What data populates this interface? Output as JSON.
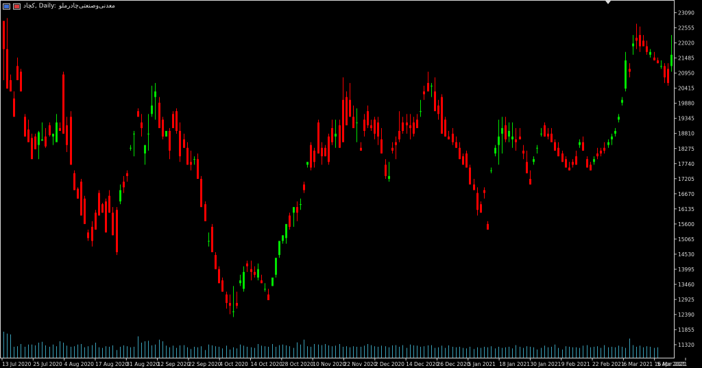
{
  "header": {
    "title": "کچاد, Daily:",
    "subtitle": "معدنی‌وصنعتی‌چادرملو"
  },
  "colors": {
    "background": "#000000",
    "up": "#00e600",
    "down": "#ff0000",
    "volume": "#3aa0b8",
    "text": "#dddddd",
    "axis": "#c8c8c8"
  },
  "chart_data": {
    "type": "candlestick",
    "title": "کچاد, Daily:",
    "subtitle": "معدنی‌وصنعتی‌چادرملو",
    "x_tick_labels": [
      "13 Jul 2020",
      "25 Jul 2020",
      "4 Aug 2020",
      "17 Aug 2020",
      "31 Aug 2020",
      "12 Sep 2020",
      "22 Sep 2020",
      "4 Oct 2020",
      "14 Oct 2020",
      "28 Oct 2020",
      "10 Nov 2020",
      "22 Nov 2020",
      "2 Dec 2020",
      "14 Dec 2020",
      "26 Dec 2020",
      "5 Jan 2021",
      "18 Jan 2021",
      "30 Jan 2021",
      "9 Feb 2021",
      "22 Feb 2021",
      "6 Mar 2021",
      "16 Mar 2021",
      "5 Apr 2021"
    ],
    "y_tick_labels": [
      "23090",
      "22555",
      "22020",
      "21485",
      "20950",
      "20415",
      "19880",
      "19345",
      "18810",
      "18275",
      "17740",
      "17205",
      "16670",
      "16135",
      "15600",
      "15065",
      "14530",
      "13995",
      "13460",
      "12925",
      "12390",
      "11855",
      "11320"
    ],
    "ylim": [
      11150,
      23250
    ],
    "volume_scale_max": 100,
    "candles": [
      [
        22800,
        22800,
        20700,
        21800
      ],
      [
        21800,
        22900,
        20500,
        20400
      ],
      [
        20700,
        20900,
        20300,
        20300
      ],
      [
        20050,
        20300,
        19400,
        19400
      ],
      [
        21200,
        21500,
        20700,
        20700
      ],
      [
        21000,
        21100,
        20300,
        20300
      ],
      [
        19400,
        19500,
        18700,
        18700
      ],
      [
        18950,
        19300,
        18500,
        18500
      ],
      [
        18650,
        18800,
        17900,
        17900
      ],
      [
        18700,
        18800,
        18250,
        18250
      ],
      [
        18400,
        18900,
        17900,
        18850
      ],
      [
        18550,
        19200,
        18600,
        18600
      ],
      [
        18700,
        19000,
        18300,
        18350
      ],
      [
        19100,
        19200,
        18700,
        18750
      ],
      [
        18700,
        18800,
        18400,
        18800
      ],
      [
        18500,
        19500,
        18500,
        19200
      ],
      [
        19000,
        19200,
        18900,
        18900
      ],
      [
        20900,
        21000,
        18800,
        18800
      ],
      [
        19100,
        19400,
        18150,
        18400
      ],
      [
        19400,
        19600,
        17700,
        17700
      ],
      [
        17400,
        17500,
        16800,
        16800
      ],
      [
        16850,
        16900,
        16500,
        16500
      ],
      [
        17100,
        17200,
        15900,
        15900
      ],
      [
        16500,
        16600,
        15600,
        15600
      ],
      [
        15300,
        15400,
        15000,
        15100
      ],
      [
        15500,
        15700,
        14800,
        15000
      ],
      [
        16000,
        16100,
        15400,
        15400
      ],
      [
        16700,
        16800,
        15900,
        15900
      ],
      [
        16300,
        16350,
        16000,
        16000
      ],
      [
        16400,
        16500,
        15300,
        15300
      ],
      [
        16600,
        16800,
        16000,
        16000
      ],
      [
        16000,
        16200,
        15200,
        15200
      ],
      [
        16100,
        16200,
        14500,
        14600
      ],
      [
        16400,
        17000,
        16300,
        16800
      ],
      [
        17100,
        17300,
        16700,
        16900
      ],
      [
        17400,
        17500,
        17100,
        17300
      ],
      [
        18300,
        18400,
        18200,
        18300
      ],
      [
        18800,
        18900,
        18000,
        18800
      ],
      [
        19600,
        19700,
        19500,
        19400
      ],
      [
        19200,
        19500,
        18700,
        19000
      ],
      [
        18100,
        18300,
        17700,
        18400
      ],
      [
        18800,
        19500,
        18200,
        18800
      ],
      [
        19500,
        20500,
        19400,
        19800
      ],
      [
        20100,
        20600,
        19300,
        20300
      ],
      [
        19900,
        20100,
        19400,
        19000
      ],
      [
        19300,
        19400,
        18600,
        18700
      ],
      [
        18700,
        18800,
        18700,
        18900
      ],
      [
        18900,
        19000,
        17900,
        18200
      ],
      [
        19500,
        19600,
        19100,
        19000
      ],
      [
        19600,
        19700,
        18800,
        18900
      ],
      [
        18900,
        19200,
        17800,
        18000
      ],
      [
        18600,
        18800,
        18300,
        18300
      ],
      [
        18300,
        18500,
        17700,
        17700
      ],
      [
        17800,
        18200,
        17500,
        17700
      ],
      [
        17900,
        18000,
        17700,
        17900
      ],
      [
        17900,
        18100,
        17200,
        17200
      ],
      [
        17200,
        17300,
        16200,
        16200
      ],
      [
        16300,
        16400,
        15800,
        15700
      ],
      [
        15000,
        15300,
        14800,
        15000
      ],
      [
        15500,
        15600,
        14700,
        14600
      ],
      [
        14500,
        14600,
        14000,
        14000
      ],
      [
        14000,
        14100,
        13500,
        13500
      ],
      [
        13600,
        13700,
        13200,
        13200
      ],
      [
        13100,
        13200,
        12600,
        12800
      ],
      [
        12800,
        13100,
        12400,
        12700
      ],
      [
        12500,
        13400,
        12300,
        12500
      ],
      [
        12800,
        13200,
        12600,
        12700
      ],
      [
        13500,
        13800,
        13400,
        13600
      ],
      [
        13300,
        14100,
        13200,
        13900
      ],
      [
        14200,
        14300,
        13900,
        14100
      ],
      [
        14000,
        14300,
        13600,
        13900
      ],
      [
        13900,
        14100,
        13700,
        13800
      ],
      [
        13700,
        14200,
        13600,
        14000
      ],
      [
        13600,
        13800,
        13500,
        13500
      ],
      [
        13300,
        13500,
        13200,
        13300
      ],
      [
        13100,
        13300,
        13000,
        12900
      ],
      [
        13400,
        13500,
        13400,
        13700
      ],
      [
        13800,
        14000,
        13700,
        14400
      ],
      [
        14500,
        14800,
        14400,
        15000
      ],
      [
        15000,
        15200,
        14900,
        15200
      ],
      [
        15100,
        15300,
        14900,
        15600
      ],
      [
        15900,
        16000,
        15400,
        15500
      ],
      [
        16000,
        16200,
        15500,
        16200
      ],
      [
        16200,
        16400,
        15700,
        16000
      ],
      [
        16300,
        16500,
        16100,
        16300
      ],
      [
        17000,
        17100,
        16700,
        16800
      ],
      [
        17700,
        17800,
        17600,
        17800
      ],
      [
        18400,
        18500,
        17500,
        17600
      ],
      [
        18200,
        18300,
        17600,
        17800
      ],
      [
        19200,
        19300,
        18100,
        18100
      ],
      [
        18300,
        18500,
        17700,
        18000
      ],
      [
        18300,
        18400,
        18000,
        18000
      ],
      [
        18700,
        18800,
        17700,
        17800
      ],
      [
        19000,
        19300,
        18400,
        18500
      ],
      [
        18700,
        19300,
        18300,
        18800
      ],
      [
        19100,
        19300,
        18400,
        18300
      ],
      [
        20000,
        20800,
        18900,
        18500
      ],
      [
        20100,
        20300,
        19200,
        19100
      ],
      [
        20000,
        20600,
        19600,
        19400
      ],
      [
        19400,
        19800,
        19000,
        19000
      ],
      [
        19200,
        19700,
        18500,
        19200
      ],
      [
        18300,
        18500,
        18200,
        18200
      ],
      [
        19300,
        19500,
        18700,
        18900
      ],
      [
        19600,
        19800,
        19000,
        19100
      ],
      [
        19100,
        19300,
        18900,
        19000
      ],
      [
        19300,
        19400,
        18600,
        18800
      ],
      [
        19200,
        19400,
        18400,
        18700
      ],
      [
        18600,
        19000,
        18100,
        18100
      ],
      [
        17700,
        17900,
        17200,
        17300
      ],
      [
        17200,
        17800,
        17100,
        17300
      ],
      [
        18300,
        18500,
        18100,
        18200
      ],
      [
        18500,
        18700,
        17900,
        18400
      ],
      [
        18900,
        19600,
        18500,
        18600
      ],
      [
        19200,
        19400,
        18800,
        18900
      ],
      [
        19200,
        19500,
        18800,
        19100
      ],
      [
        19100,
        19500,
        18600,
        19000
      ],
      [
        19200,
        19400,
        18700,
        18800
      ],
      [
        19300,
        19500,
        19000,
        19000
      ],
      [
        19600,
        20000,
        19400,
        19600
      ],
      [
        20300,
        20500,
        20000,
        20200
      ],
      [
        20600,
        21000,
        20400,
        20300
      ],
      [
        20500,
        20600,
        20100,
        20500
      ],
      [
        20300,
        20800,
        19800,
        19600
      ],
      [
        19800,
        20000,
        19300,
        19500
      ],
      [
        20100,
        20200,
        18800,
        18800
      ],
      [
        19300,
        19400,
        18700,
        18700
      ],
      [
        18700,
        18900,
        18600,
        18600
      ],
      [
        18800,
        19000,
        18400,
        18500
      ],
      [
        18500,
        18700,
        18300,
        18300
      ],
      [
        18300,
        18500,
        17900,
        17900
      ],
      [
        18000,
        18100,
        17700,
        17700
      ],
      [
        18100,
        18200,
        17600,
        17600
      ],
      [
        17600,
        17700,
        17100,
        17000
      ],
      [
        17000,
        17200,
        16800,
        16800
      ],
      [
        16700,
        16900,
        15900,
        16100
      ],
      [
        16300,
        16400,
        16000,
        16000
      ],
      [
        16800,
        16900,
        16500,
        16700
      ],
      [
        15600,
        15700,
        15400,
        15400
      ],
      [
        17500,
        17600,
        17400,
        17500
      ],
      [
        18100,
        18400,
        18000,
        18300
      ],
      [
        18400,
        19300,
        17700,
        18700
      ],
      [
        18800,
        19400,
        18100,
        19000
      ],
      [
        19100,
        19400,
        18500,
        18600
      ],
      [
        18700,
        19200,
        18500,
        18900
      ],
      [
        18600,
        19200,
        18300,
        18700
      ],
      [
        18600,
        19000,
        18200,
        18500
      ],
      [
        18700,
        19000,
        18600,
        18600
      ],
      [
        18200,
        18400,
        17900,
        18100
      ],
      [
        17800,
        18200,
        17400,
        17400
      ],
      [
        17200,
        17500,
        17000,
        17000
      ],
      [
        17800,
        18000,
        17700,
        17900
      ],
      [
        18300,
        18400,
        18100,
        18300
      ],
      [
        18800,
        19000,
        18700,
        18800
      ],
      [
        19100,
        19200,
        18700,
        18700
      ],
      [
        18800,
        19000,
        18600,
        18700
      ],
      [
        18800,
        19000,
        18500,
        18500
      ],
      [
        18500,
        18600,
        18200,
        18200
      ],
      [
        18300,
        18500,
        18000,
        18000
      ],
      [
        18100,
        18200,
        17800,
        17800
      ],
      [
        17900,
        18000,
        17600,
        17600
      ],
      [
        17600,
        17800,
        17500,
        17500
      ],
      [
        17800,
        17900,
        17600,
        17700
      ],
      [
        18000,
        18200,
        17700,
        17700
      ],
      [
        18400,
        18600,
        18300,
        18500
      ],
      [
        18500,
        18700,
        18200,
        18200
      ],
      [
        17900,
        18000,
        17600,
        17600
      ],
      [
        17700,
        17800,
        17500,
        17500
      ],
      [
        17800,
        18000,
        17700,
        17900
      ],
      [
        18100,
        18300,
        17900,
        18000
      ],
      [
        18200,
        18300,
        18000,
        18100
      ],
      [
        18300,
        18500,
        18100,
        18200
      ],
      [
        18400,
        18600,
        18300,
        18500
      ],
      [
        18600,
        18800,
        18400,
        18700
      ],
      [
        18800,
        19000,
        18700,
        18900
      ],
      [
        19300,
        19500,
        19200,
        19400
      ],
      [
        19900,
        20100,
        19800,
        20000
      ],
      [
        20400,
        21700,
        20300,
        21400
      ],
      [
        21100,
        21300,
        20800,
        21000
      ],
      [
        21900,
        22300,
        21600,
        22000
      ],
      [
        22200,
        22700,
        21800,
        22100
      ],
      [
        22300,
        22600,
        21700,
        21900
      ],
      [
        22100,
        22300,
        21900,
        21900
      ],
      [
        21900,
        22100,
        21600,
        21700
      ],
      [
        21600,
        21800,
        21500,
        21700
      ],
      [
        21500,
        21700,
        21400,
        21400
      ],
      [
        21400,
        21500,
        21300,
        21300
      ],
      [
        21200,
        21400,
        21100,
        21200
      ],
      [
        21200,
        21300,
        20600,
        20800
      ],
      [
        21100,
        21300,
        20500,
        20600
      ],
      [
        21200,
        22300,
        21000,
        21600
      ]
    ],
    "volumes": [
      95,
      88,
      85,
      40,
      42,
      50,
      40,
      48,
      48,
      45,
      55,
      58,
      45,
      40,
      48,
      42,
      60,
      55,
      44,
      40,
      42,
      48,
      50,
      38,
      42,
      46,
      55,
      38,
      36,
      42,
      40,
      45,
      28,
      40,
      45,
      42,
      38,
      40,
      78,
      55,
      60,
      62,
      45,
      48,
      66,
      60,
      44,
      38,
      44,
      36,
      45,
      46,
      38,
      32,
      40,
      38,
      42,
      28,
      48,
      45,
      42,
      40,
      34,
      44,
      30,
      38,
      34,
      48,
      44,
      40,
      38,
      36,
      50,
      44,
      42,
      40,
      50,
      40,
      46,
      48,
      45,
      42,
      36,
      56,
      48,
      66,
      42,
      40,
      50,
      48,
      46,
      50,
      45,
      42,
      44,
      50,
      40,
      42,
      38,
      42,
      40,
      40,
      44,
      50,
      46,
      42,
      40,
      44,
      42,
      38,
      45,
      46,
      40,
      46,
      36,
      48,
      45,
      44,
      40,
      42,
      45,
      46,
      36,
      38,
      44,
      36,
      45,
      40,
      38,
      40,
      36,
      34,
      40,
      32,
      38,
      36,
      40,
      38,
      42,
      34,
      40,
      36,
      38,
      40,
      34,
      46,
      40,
      36,
      42,
      40,
      38,
      30,
      36,
      44,
      38,
      40,
      48,
      36,
      30,
      42,
      40,
      38,
      38,
      36,
      44,
      46,
      38,
      40,
      42,
      36,
      46,
      38,
      40,
      38,
      44,
      40,
      36,
      70,
      46,
      40,
      44,
      38,
      42,
      40,
      36,
      38
    ]
  }
}
